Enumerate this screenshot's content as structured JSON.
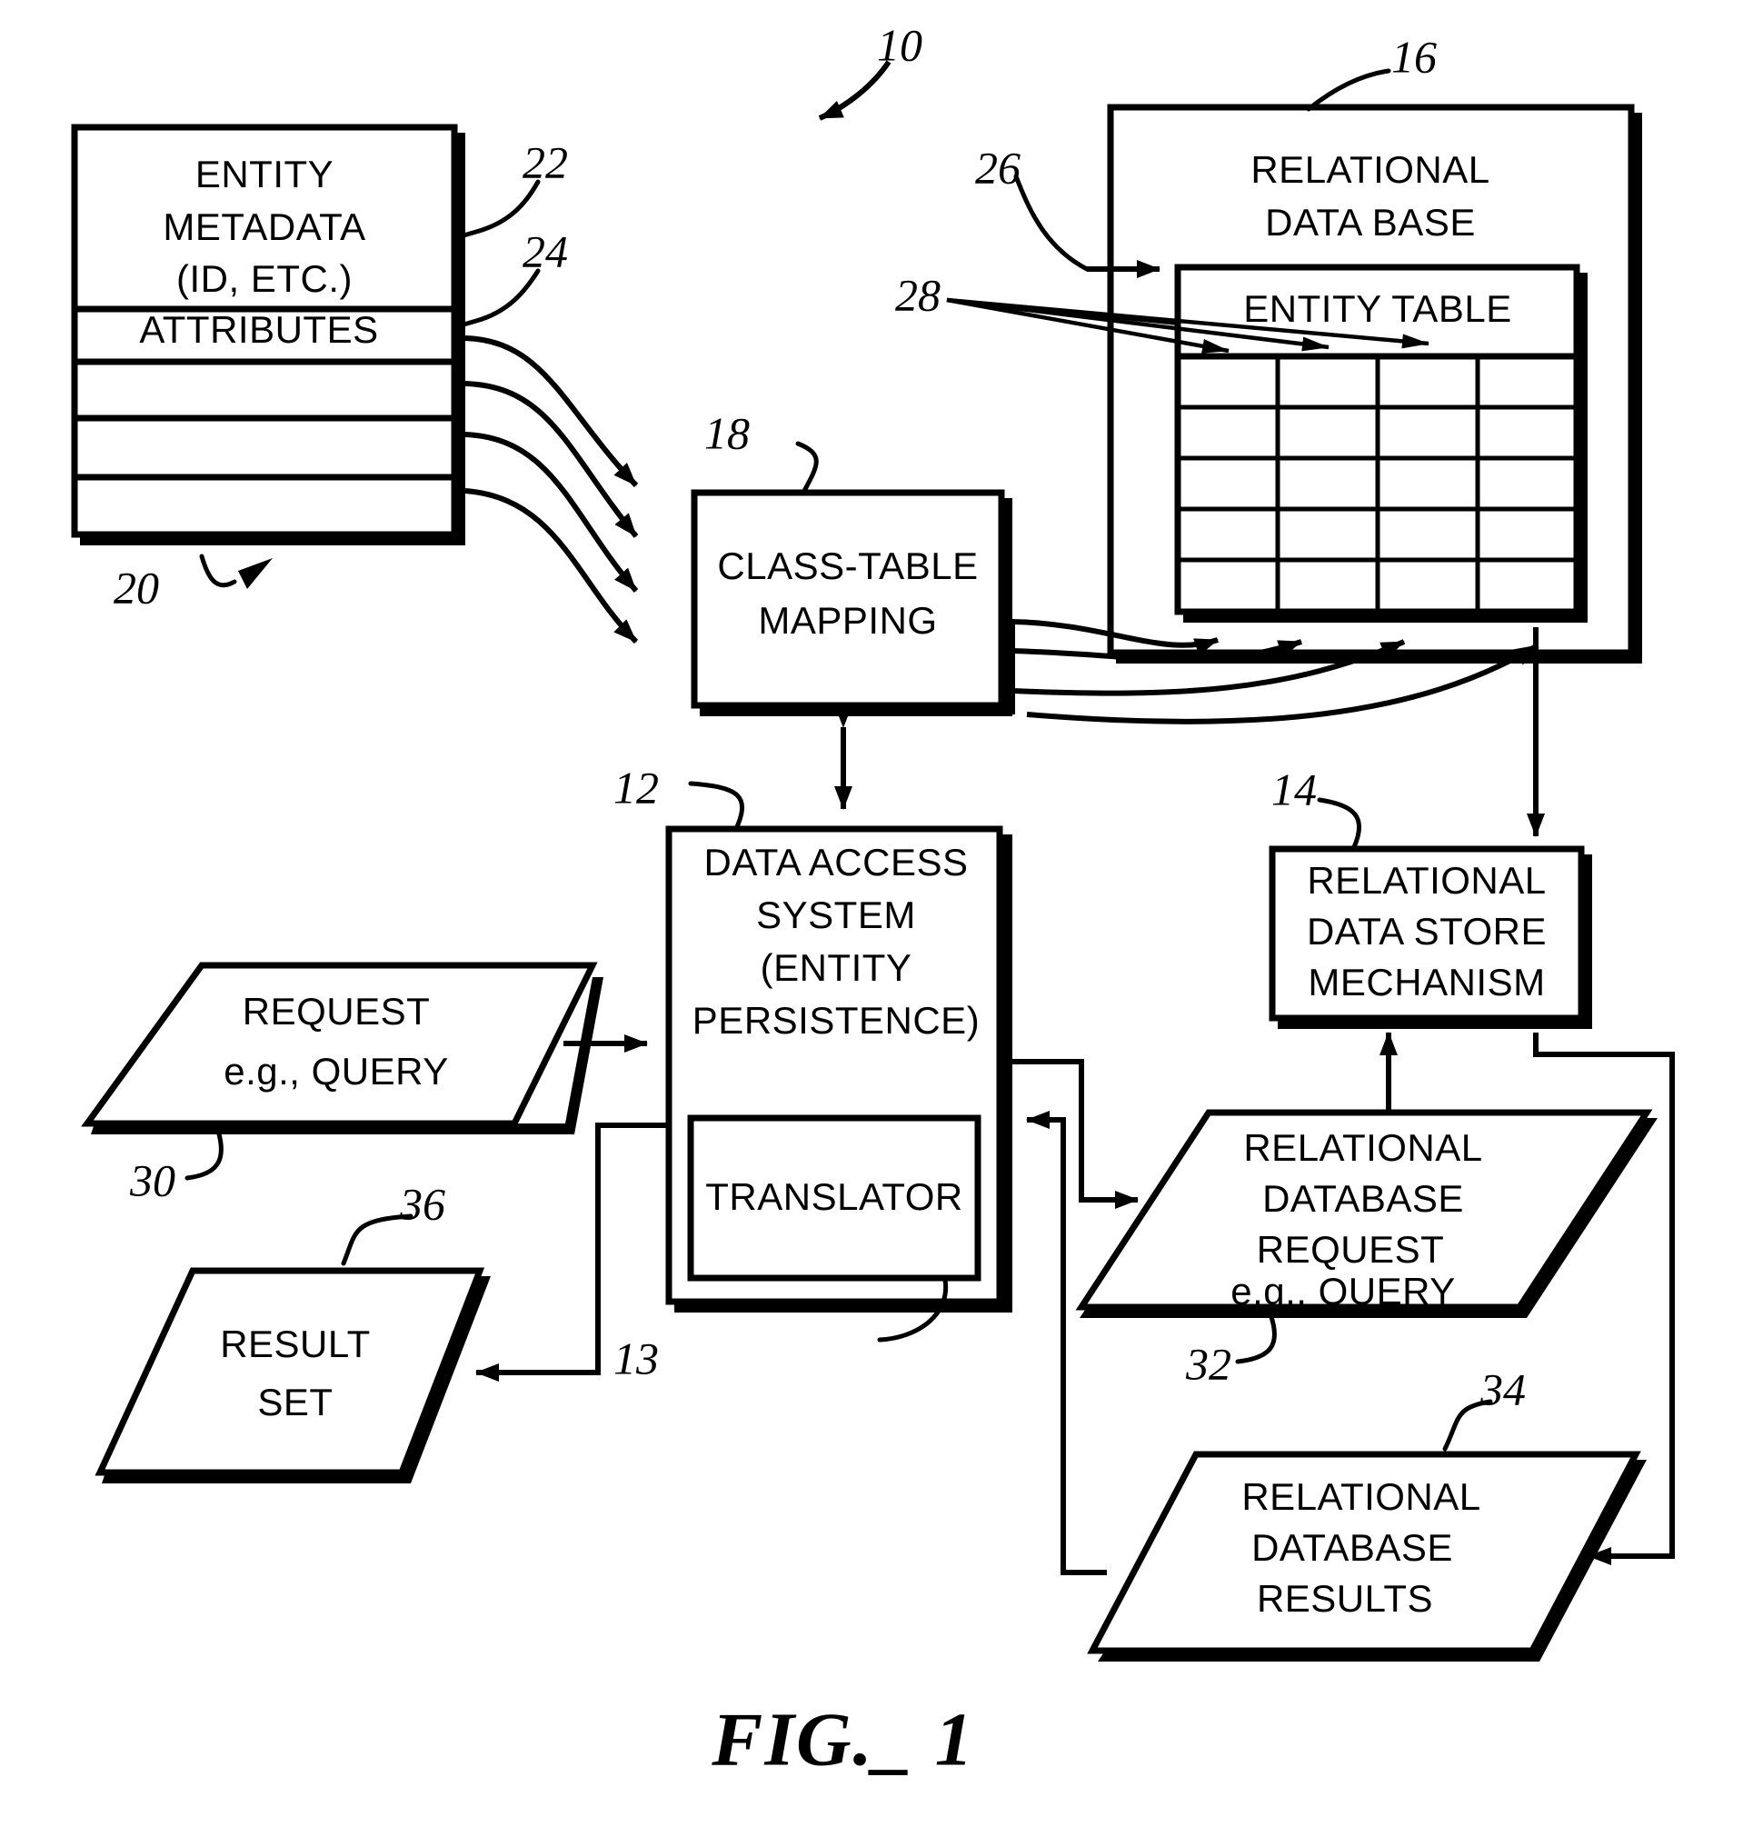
{
  "figure": {
    "caption": "FIG._ 1",
    "reference_numeral_main": "10"
  },
  "nodes": {
    "entity_metadata": {
      "ref": "20",
      "title_line1": "ENTITY",
      "title_line2": "METADATA",
      "title_line3": "(ID, ETC.)",
      "attributes_label": "ATTRIBUTES",
      "ref_metadata": "22",
      "ref_attributes": "24",
      "empty_rows": 3
    },
    "class_table_mapping": {
      "ref": "18",
      "line1": "CLASS-TABLE",
      "line2": "MAPPING"
    },
    "relational_database": {
      "ref": "16",
      "line1": "RELATIONAL",
      "line2": "DATA BASE",
      "entity_table_label": "ENTITY TABLE",
      "ref_entity_table": "26",
      "ref_columns": "28",
      "table_columns": 4,
      "table_rows": 5
    },
    "data_access_system": {
      "ref": "12",
      "line1": "DATA ACCESS",
      "line2": "SYSTEM",
      "line3": "(ENTITY",
      "line4": "PERSISTENCE)",
      "translator_label": "TRANSLATOR",
      "ref_translator": "13"
    },
    "relational_data_store": {
      "ref": "14",
      "line1": "RELATIONAL",
      "line2": "DATA STORE",
      "line3": "MECHANISM"
    },
    "request": {
      "ref": "30",
      "line1": "REQUEST",
      "line2": "e.g., QUERY"
    },
    "result_set": {
      "ref": "36",
      "line1": "RESULT",
      "line2": "SET"
    },
    "relational_database_request": {
      "ref": "32",
      "line1": "RELATIONAL",
      "line2": "DATABASE",
      "line3": "REQUEST",
      "line4": "e.g., QUERY"
    },
    "relational_database_results": {
      "ref": "34",
      "line1": "RELATIONAL",
      "line2": "DATABASE",
      "line3": "RESULTS"
    }
  },
  "colors": {
    "ink": "#000000",
    "paper": "#ffffff"
  }
}
